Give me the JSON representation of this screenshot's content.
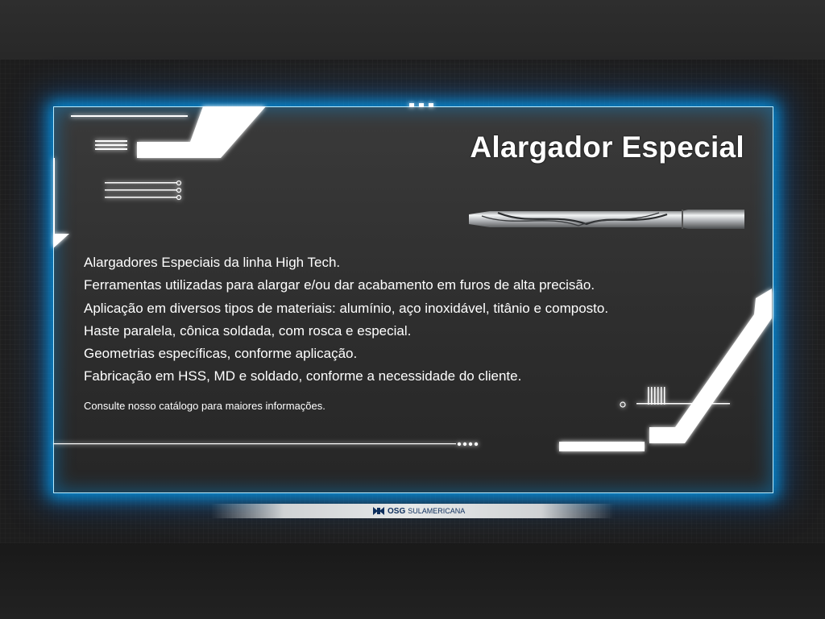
{
  "title": "Alargador Especial",
  "lines": [
    "Alargadores Especiais da linha High Tech.",
    "Ferramentas utilizadas para alargar e/ou dar acabamento em furos de alta precisão.",
    "Aplicação em diversos tipos de materiais: alumínio, aço inoxidável, titânio e composto.",
    "Haste paralela, cônica soldada, com rosca e especial.",
    "Geometrias específicas, conforme aplicação.",
    "Fabricação em HSS, MD e soldado, conforme a necessidade do cliente."
  ],
  "note": "Consulte nosso catálogo para maiores informações.",
  "logo": {
    "brand": "OSG",
    "suffix": "SULAMERICANA"
  },
  "colors": {
    "glow": "#00aaff",
    "frame": "#b9ecff",
    "text": "#ffffff"
  }
}
